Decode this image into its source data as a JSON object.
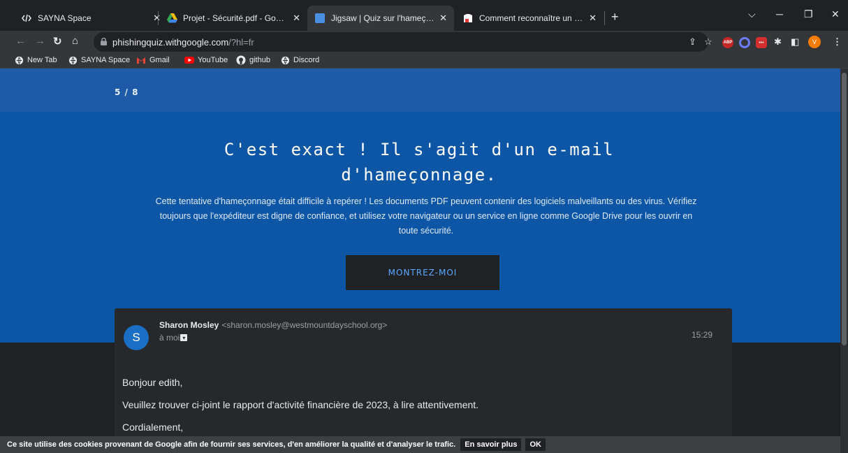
{
  "tabs": [
    {
      "title": "SAYNA Space",
      "icon": "sayna-icon"
    },
    {
      "title": "Projet - Sécurité.pdf - Google Dri",
      "icon": "google-drive-icon"
    },
    {
      "title": "Jigsaw | Quiz sur l'hameçonnage",
      "icon": "jigsaw-icon",
      "active": true
    },
    {
      "title": "Comment reconnaître un mail de",
      "icon": "article-icon"
    }
  ],
  "address_bar": {
    "host": "phishingquiz.withgoogle.com",
    "path": "/?hl=fr"
  },
  "profile_initial": "V",
  "extensions": {
    "abp_label": "ABP",
    "dots_label": "•••"
  },
  "bookmarks": [
    {
      "label": "New Tab",
      "icon": "globe-icon"
    },
    {
      "label": "SAYNA Space",
      "icon": "globe-icon"
    },
    {
      "label": "Gmail",
      "icon": "gmail-icon"
    },
    {
      "label": "YouTube",
      "icon": "youtube-icon"
    },
    {
      "label": "github",
      "icon": "github-icon"
    },
    {
      "label": "Discord",
      "icon": "globe-icon"
    }
  ],
  "quiz": {
    "progress": "5 / 8",
    "headline_line1": "C'est exact ! Il s'agit d'un e-mail",
    "headline_line2": "d'hameçonnage.",
    "explanation": "Cette tentative d'hameçonnage était difficile à repérer ! Les documents PDF peuvent contenir des logiciels malveillants ou des virus. Vérifiez toujours que l'expéditeur est digne de confiance, et utilisez votre navigateur ou un service en ligne comme Google Drive pour les ouvrir en toute sécurité.",
    "cta_label": "MONTREZ-MOI"
  },
  "email": {
    "avatar_initial": "S",
    "sender_name": "Sharon Mosley",
    "sender_address": "<sharon.mosley@westmountdayschool.org>",
    "recipient": "à moi",
    "time": "15:29",
    "body": [
      "Bonjour edith,",
      "Veuillez trouver ci-joint le rapport d'activité financière de 2023, à lire attentivement.",
      "Cordialement,"
    ]
  },
  "cookie": {
    "text": "Ce site utilise des cookies provenant de Google afin de fournir ses services, d'en améliorer la qualité et d'analyser le trafic.",
    "learn_more": "En savoir plus",
    "ok": "OK"
  },
  "colors": {
    "progress_band": "#1e5aa8",
    "hero": "#0d56a6",
    "cta_text": "#5aa9ff",
    "avatar": "#1a6fc4"
  }
}
